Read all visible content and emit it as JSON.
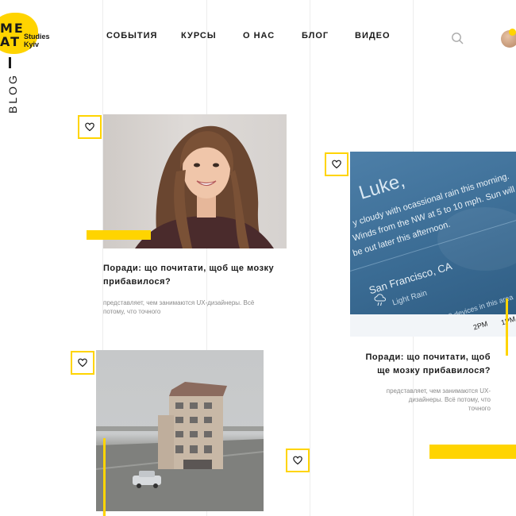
{
  "logo": {
    "big": "ME\nAT",
    "small_line1": "Studies",
    "small_line2": "Kyiv"
  },
  "nav": {
    "items": [
      {
        "label": "СОБЫТИЯ"
      },
      {
        "label": "КУРСЫ"
      },
      {
        "label": "О НАС"
      },
      {
        "label": "БЛОГ"
      },
      {
        "label": "ВИДЕО"
      }
    ]
  },
  "page": {
    "side_label": "BLOG"
  },
  "cards": [
    {
      "title": "Поради: що почитати, щоб ще мозку\nприбавилося?",
      "description": "представляет, чем занимаются UX-дизайнеры. Всё\nпотому, что точного"
    },
    {
      "title": "Поради: що почитати, щоб\nще мозку прибавилося?",
      "description": "представляет, чем занимаются UX-\nдизайнеры. Всё потому, что\nточного",
      "photo_text": {
        "greeting": "Luke,",
        "line1": "y cloudy with ocassional rain this morning.",
        "line2": "Winds from the NW at 5 to 10 mph. Sun will",
        "line3": "be out later this afternoon.",
        "city": "San Francisco, CA",
        "condition": "Light Rain",
        "footer": "Collected from 48 devices in this area",
        "time1": "2PM",
        "time2": "1PM"
      }
    },
    {}
  ],
  "colors": {
    "accent": "#ffd400",
    "text": "#1a1a1a",
    "muted": "#8a8a8a"
  },
  "icons": {
    "search": "search-icon",
    "heart": "heart-icon"
  }
}
